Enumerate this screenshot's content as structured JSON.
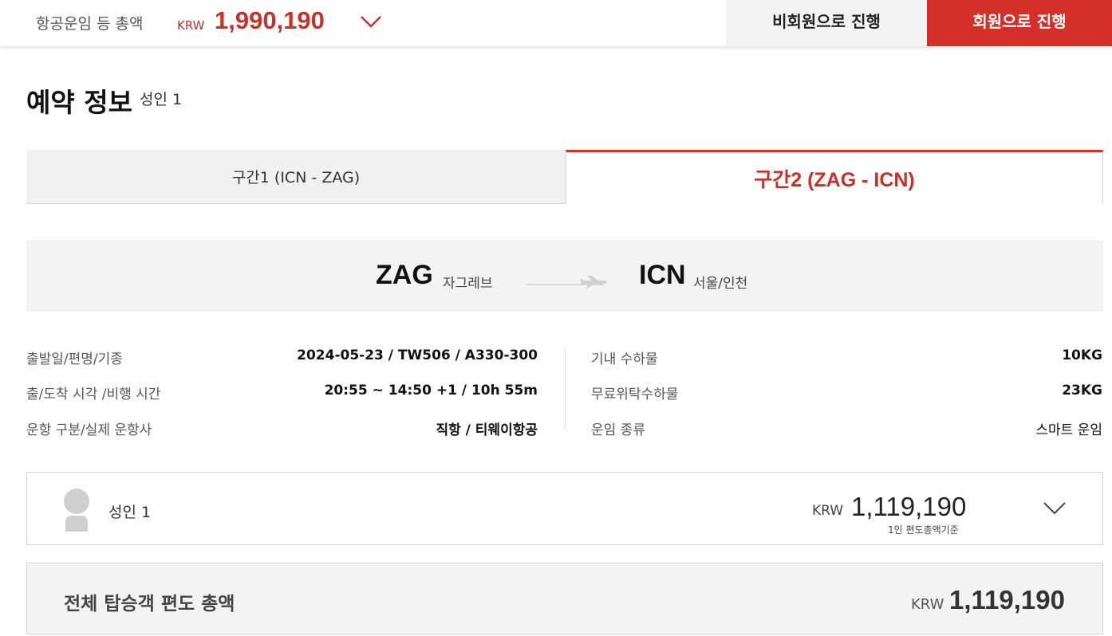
{
  "topbar": {
    "total_label": "항공운임 등 총액",
    "currency": "KRW",
    "total_amount": "1,990,190",
    "expand_icon": "chevron-down-icon",
    "guest_button": "비회원으로 진행",
    "member_button": "회원으로 진행",
    "accent_color": "#d3302a"
  },
  "booking": {
    "title": "예약 정보",
    "passenger_count": "성인 1"
  },
  "tabs": [
    {
      "label": "구간1 (ICN - ZAG)",
      "active": false
    },
    {
      "label": "구간2 (ZAG - ICN)",
      "active": true
    }
  ],
  "route": {
    "origin_code": "ZAG",
    "origin_city": "자그레브",
    "destination_code": "ICN",
    "destination_city": "서울/인천",
    "icon": "airplane-icon"
  },
  "flight_info": {
    "left": [
      {
        "label": "출발일/편명/기종",
        "value": "2024-05-23 / TW506 / A330-300"
      },
      {
        "label": "출/도착 시각 /비행 시간",
        "value": "20:55 ~ 14:50 +1 / 10h 55m"
      },
      {
        "label": "운항 구분/실제 운항사",
        "value": "직항 / 티웨이항공"
      }
    ],
    "right": [
      {
        "label": "기내 수하물",
        "value": "10KG"
      },
      {
        "label": "무료위탁수하물",
        "value": "23KG"
      },
      {
        "label": "운임 종류",
        "value": "스마트 운임"
      }
    ]
  },
  "passenger": {
    "name": "성인 1",
    "currency": "KRW",
    "amount": "1,119,190",
    "note": "1인 편도총액기준",
    "avatar_icon": "person-avatar-icon",
    "expand_icon": "chevron-down-icon"
  },
  "total": {
    "label": "전체 탑승객 편도 총액",
    "currency": "KRW",
    "amount": "1,119,190"
  }
}
